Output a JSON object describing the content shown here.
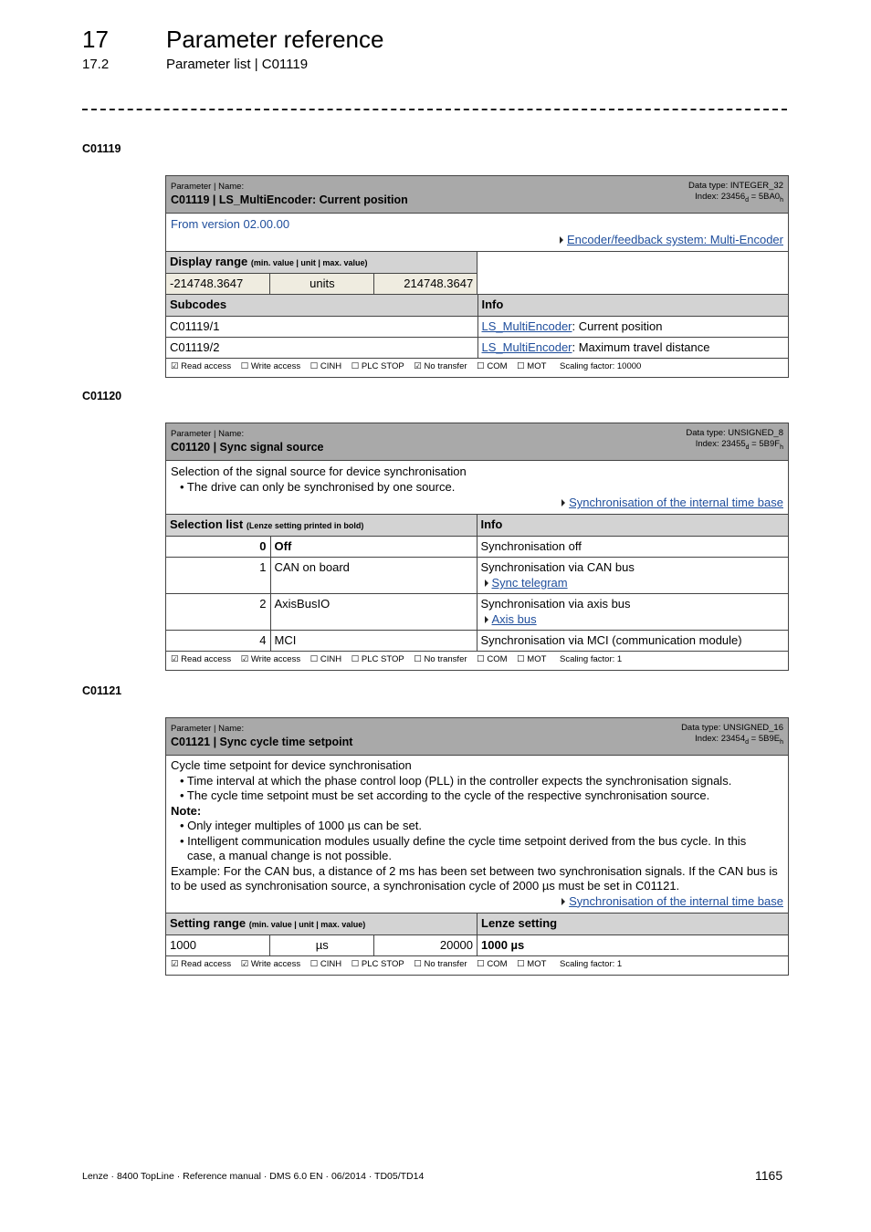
{
  "header": {
    "chapter_number": "17",
    "chapter_title": "Parameter reference",
    "section_number": "17.2",
    "section_title": "Parameter list | C01119"
  },
  "params": [
    {
      "label": "C01119",
      "name_caption": "Parameter | Name:",
      "title": "C01119 | LS_MultiEncoder: Current position",
      "data_type": "Data type: INTEGER_32",
      "index_prefix": "Index: 23456",
      "index_d": "d",
      "index_mid": " = 5BA0",
      "index_h": "h",
      "version": "From version 02.00.00",
      "link": "Encoder/feedback system: Multi-Encoder",
      "range_header": "Display range",
      "range_sub": "(min. value | unit | max. value)",
      "range_min": "-214748.3647",
      "range_unit": "units",
      "range_max": "214748.3647",
      "subcodes_header": "Subcodes",
      "info_header": "Info",
      "subcodes": [
        {
          "code": "C01119/1",
          "link": "LS_MultiEncoder",
          "text": ": Current position"
        },
        {
          "code": "C01119/2",
          "link": "LS_MultiEncoder",
          "text": ": Maximum travel distance"
        }
      ],
      "flags": [
        "☑ Read access",
        "☐ Write access",
        "☐ CINH",
        "☐ PLC STOP",
        "☑ No transfer",
        "☐ COM",
        "☐ MOT"
      ],
      "scaling": "Scaling factor: 10000"
    },
    {
      "label": "C01120",
      "name_caption": "Parameter | Name:",
      "title": "C01120 | Sync signal source",
      "data_type": "Data type: UNSIGNED_8",
      "index_prefix": "Index: 23455",
      "index_d": "d",
      "index_mid": " = 5B9F",
      "index_h": "h",
      "desc": "Selection of the signal source for device synchronisation",
      "bullets": [
        "• The drive can only be synchronised by one source."
      ],
      "link": "Synchronisation of the internal time base",
      "list_header": "Selection list",
      "list_sub": "(Lenze setting printed in bold)",
      "info_header": "Info",
      "options": [
        {
          "value": "0",
          "name": "Off",
          "info": "Synchronisation off",
          "link": ""
        },
        {
          "value": "1",
          "name": "CAN on board",
          "info": "Synchronisation via CAN bus",
          "link": "Sync telegram"
        },
        {
          "value": "2",
          "name": "AxisBusIO",
          "info": "Synchronisation via axis bus",
          "link": "Axis bus"
        },
        {
          "value": "4",
          "name": "MCI",
          "info": "Synchronisation via MCI (communication module)",
          "link": ""
        }
      ],
      "flags": [
        "☑ Read access",
        "☑ Write access",
        "☐ CINH",
        "☐ PLC STOP",
        "☐ No transfer",
        "☐ COM",
        "☐ MOT"
      ],
      "scaling": "Scaling factor: 1"
    },
    {
      "label": "C01121",
      "name_caption": "Parameter | Name:",
      "title": "C01121 | Sync cycle time setpoint",
      "data_type": "Data type: UNSIGNED_16",
      "index_prefix": "Index: 23454",
      "index_d": "d",
      "index_mid": " = 5B9E",
      "index_h": "h",
      "desc": "Cycle time setpoint for device synchronisation",
      "bullets": [
        "• Time interval at which the phase control loop (PLL) in the controller expects the synchronisation signals.",
        "• The cycle time setpoint must be set according to the cycle of the respective synchronisation source."
      ],
      "note_label": "Note:",
      "note_bullets": [
        "• Only integer multiples of 1000 µs can be set.",
        "• Intelligent communication modules usually define the cycle time setpoint derived from the bus cycle. In this",
        "case, a manual change is not possible."
      ],
      "example": "Example: For the CAN bus, a distance of 2 ms has been set between two synchronisation signals. If the CAN bus is to be used as synchronisation source, a synchronisation cycle of 2000 µs must be set in C01121.",
      "link": "Synchronisation of the internal time base",
      "range_header": "Setting range",
      "range_sub": "(min. value | unit | max. value)",
      "lenze_header": "Lenze setting",
      "range_min": "1000",
      "range_unit": "µs",
      "range_max": "20000",
      "lenze_value": "1000 µs",
      "flags": [
        "☑ Read access",
        "☑ Write access",
        "☐ CINH",
        "☐ PLC STOP",
        "☐ No transfer",
        "☐ COM",
        "☐ MOT"
      ],
      "scaling": "Scaling factor: 1"
    }
  ],
  "footer": {
    "text": "Lenze · 8400 TopLine · Reference manual · DMS 6.0 EN · 06/2014 · TD05/TD14",
    "page": "1165"
  }
}
